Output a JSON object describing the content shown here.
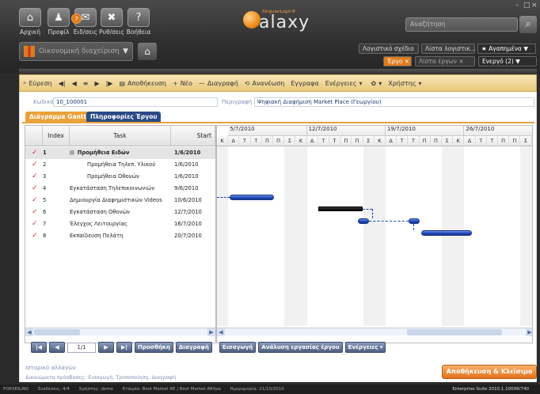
{
  "window": {
    "controls": [
      "–",
      "□",
      "×"
    ]
  },
  "nav": [
    {
      "label": "Αρχική",
      "icon": "home-icon",
      "glyph": "⌂"
    },
    {
      "label": "Προφίλ",
      "icon": "profile-icon",
      "glyph": "♟"
    },
    {
      "label": "Ειδ/σεις",
      "icon": "notifications-icon",
      "glyph": "✉"
    },
    {
      "label": "Ρυθ/σεις",
      "icon": "settings-icon",
      "glyph": "✖"
    },
    {
      "label": "Βοήθεια",
      "icon": "help-icon",
      "glyph": "?"
    }
  ],
  "notification_count": "7",
  "logo": {
    "sub": "SingularLogic®",
    "word": "alaxy"
  },
  "search": {
    "placeholder": "Αναζήτηση"
  },
  "module": {
    "label": "Οικονομική διαχείριση"
  },
  "right_tabs_row1": [
    "Λογιστικό σχέδιο",
    "Λίστα λογιστικ...",
    "★ Αγαπημένα ▼"
  ],
  "right_tabs_row2": [
    "Έργο ×",
    "Λίστα έργων ×",
    "Ενεργό (2) ▼"
  ],
  "toolbar": [
    "Εύρεση",
    "Αποθήκευση",
    "Νέο",
    "Διαγραφή",
    "Ανανέωση",
    "Εγγραφα",
    "Ενέργειες",
    "Χρήστης"
  ],
  "form": {
    "code_label": "Κωδικός",
    "code_value": "10_100001",
    "desc_label": "Περιγραφή",
    "desc_value": "Ψηφιακή Διαφήμιση Market Place (Γεωργίου)"
  },
  "page_tabs": [
    "Διάγραμμα Gantt",
    "Πληροφορίες Έργου"
  ],
  "grid": {
    "headers": {
      "index": "Index",
      "task": "Task",
      "start": "Start"
    },
    "rows": [
      {
        "index": "1",
        "task": "Προμήθεια Ειδών",
        "start": "1/6/2010",
        "level": 0,
        "group": true
      },
      {
        "index": "2",
        "task": "Προμήθεια Τηλεπ. Υλικού",
        "start": "1/6/2010",
        "level": 1
      },
      {
        "index": "3",
        "task": "Προμήθεια Οθονών",
        "start": "1/6/2010",
        "level": 1
      },
      {
        "index": "4",
        "task": "Εγκατάσταση Τηλεπικοινωνιών",
        "start": "9/6/2010",
        "level": 0
      },
      {
        "index": "5",
        "task": "Δημιουργία Διαφημιστικών Videos",
        "start": "10/6/2010",
        "level": 0
      },
      {
        "index": "6",
        "task": "Εγκατάσταση Οθονών",
        "start": "12/7/2010",
        "level": 0
      },
      {
        "index": "7",
        "task": "Έλεγχος Λειτουργίας",
        "start": "16/7/2010",
        "level": 0
      },
      {
        "index": "8",
        "task": "Εκπαίδευση Πελάτη",
        "start": "20/7/2010",
        "level": 0
      }
    ]
  },
  "gantt": {
    "weeks": [
      "5/7/2010",
      "12/7/2010",
      "19/7/2010",
      "26/7/2010"
    ],
    "days": [
      "Κ",
      "Δ",
      "Τ",
      "Τ",
      "Π",
      "Π",
      "Σ",
      "Κ",
      "Δ",
      "Τ",
      "Τ",
      "Π",
      "Π",
      "Σ",
      "Κ",
      "Δ",
      "Τ",
      "Τ",
      "Π",
      "Π",
      "Σ",
      "Κ",
      "Δ",
      "Τ",
      "Τ",
      "Π",
      "Π",
      "Σ"
    ]
  },
  "pager": {
    "page": "1/1",
    "buttons": [
      "Προσθήκη",
      "Διαγραφή",
      "Εισαγωγή",
      "Ανάλυση εργασίας έργου",
      "Ενέργειες"
    ]
  },
  "history_label": "Ιστορικό αλλαγών",
  "permissions_label": "Δικαιώματα πρόσβασης: Εισαγωγή, Τροποποίηση, Διαγραφή",
  "save_close": "Αποθήκευση & Κλείσιμο",
  "status": {
    "user": "POPXEILAKI",
    "connections": "Συνδέσεις: 4/4",
    "username": "Χρήστης: demo",
    "company": "Εταιρία: Best Market AE / Best Market Αθήνα",
    "date": "Ημερομηνία: 21/10/2010",
    "version": "Enterprise Suite 2010.1.10099/740"
  }
}
